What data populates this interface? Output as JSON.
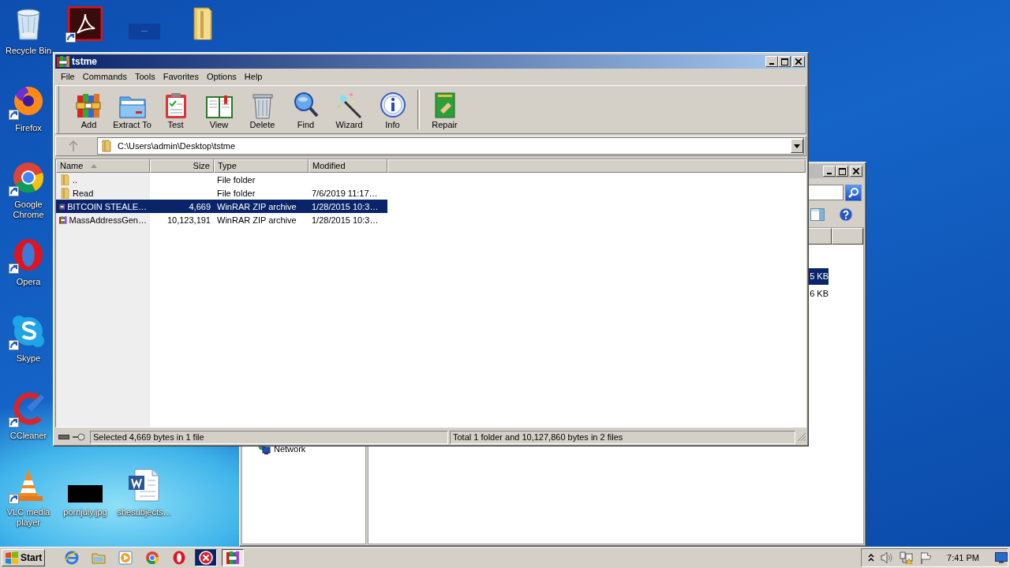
{
  "desktop_icons": [
    {
      "label": "Recycle Bin",
      "kind": "recycle",
      "shortcut": false
    },
    {
      "kind": "acrobat",
      "shortcut": true
    },
    {
      "kind": "thumb",
      "shortcut": false
    },
    {
      "kind": "folder",
      "shortcut": false
    },
    {
      "label": "Firefox",
      "kind": "firefox",
      "shortcut": true
    },
    {
      "label": "Google Chrome",
      "kind": "chrome",
      "shortcut": true
    },
    {
      "label": "Opera",
      "kind": "opera",
      "shortcut": true
    },
    {
      "label": "Skype",
      "kind": "skype",
      "shortcut": true
    },
    {
      "label": "CCleaner",
      "kind": "ccleaner",
      "shortcut": true
    },
    {
      "label": "VLC media player",
      "kind": "vlc",
      "shortcut": true
    },
    {
      "label": "pornjuly.jpg",
      "kind": "image",
      "shortcut": false
    },
    {
      "label": "shesubjects…",
      "kind": "word",
      "shortcut": false
    }
  ],
  "explorer_window": {
    "nav_items": [
      "Network"
    ],
    "rows": [
      {
        "size": "5 KB",
        "selected": true
      },
      {
        "size": "6 KB",
        "selected": false
      }
    ]
  },
  "winrar_window": {
    "title": "tstme",
    "menu": [
      "File",
      "Commands",
      "Tools",
      "Favorites",
      "Options",
      "Help"
    ],
    "toolbar": [
      {
        "kind": "add",
        "label": "Add"
      },
      {
        "kind": "extract",
        "label": "Extract To"
      },
      {
        "kind": "test",
        "label": "Test"
      },
      {
        "kind": "view",
        "label": "View"
      },
      {
        "kind": "delete",
        "label": "Delete"
      },
      {
        "kind": "find",
        "label": "Find"
      },
      {
        "kind": "wizard",
        "label": "Wizard"
      },
      {
        "kind": "info",
        "label": "Info"
      },
      {
        "kind": "separator"
      },
      {
        "kind": "repair",
        "label": "Repair"
      }
    ],
    "path": "C:\\Users\\admin\\Desktop\\tstme",
    "columns": [
      {
        "label": "Name",
        "sorted": true
      },
      {
        "label": "Size",
        "sorted": false
      },
      {
        "label": "Type",
        "sorted": false
      },
      {
        "label": "Modified",
        "sorted": false
      }
    ],
    "rows": [
      {
        "kind": "folder",
        "name": "..",
        "type": "File folder",
        "selected": false
      },
      {
        "kind": "folder",
        "name": "Read",
        "type": "File folder",
        "modified": "7/6/2019 11:17…",
        "selected": false
      },
      {
        "kind": "archive",
        "name": "BITCOIN STEALE…",
        "size": "4,669",
        "type": "WinRAR ZIP archive",
        "modified": "1/28/2015 10:3…",
        "selected": true
      },
      {
        "kind": "archive",
        "name": "MassAddressGen…",
        "size": "10,123,191",
        "type": "WinRAR ZIP archive",
        "modified": "1/28/2015 10:3…",
        "selected": false
      }
    ],
    "status_bar": {
      "selection": "Selected 4,669 bytes in 1 file",
      "total": "Total 1 folder and 10,127,860 bytes in 2 files"
    }
  },
  "taskbar": {
    "start": "Start",
    "apps": [
      {
        "kind": "ie",
        "active": false
      },
      {
        "kind": "explorer",
        "active": false
      },
      {
        "kind": "media",
        "active": false
      },
      {
        "kind": "chrome",
        "active": false
      },
      {
        "kind": "opera",
        "active": false
      },
      {
        "kind": "xapp",
        "active": true
      },
      {
        "kind": "winrar",
        "active": true
      }
    ],
    "clock": "7:41 PM"
  }
}
